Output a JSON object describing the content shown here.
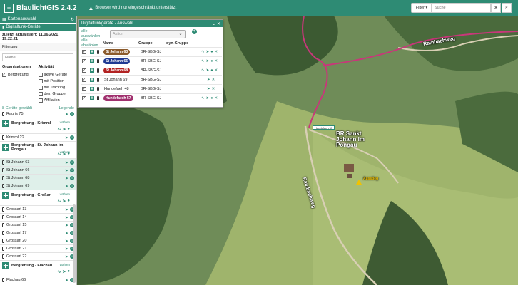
{
  "app": {
    "title": "BlaulichtGIS 2.4.2",
    "logo_icon": "cross-icon"
  },
  "warning": {
    "text": "Browser wird nur eingeschränkt unterstützt",
    "icon": "warning-icon"
  },
  "toolbar": {
    "filter_label": "Filter ▾",
    "search_placeholder": "Suche",
    "clear_icon": "close-icon",
    "search_icon": "search-icon"
  },
  "sidebar": {
    "map_select_label": "Kartenauswahl",
    "panel_title": "Digitalfunk-Geräte",
    "updated": "zuletzt aktualisiert: 11.06.2021 19:22:21",
    "filter_label": "Filterung",
    "name_placeholder": "Name",
    "org_header": "Organisationen",
    "org_items": [
      {
        "label": "Bergrettung",
        "checked": true
      }
    ],
    "act_header": "Aktivität",
    "act_items": [
      {
        "label": "aktive Geräte",
        "checked": false
      },
      {
        "label": "mit Position",
        "checked": false
      },
      {
        "label": "mit Tracking",
        "checked": false
      },
      {
        "label": "dyn. Gruppe",
        "checked": false
      },
      {
        "label": "Affiliation",
        "checked": false
      }
    ],
    "count_label": "8 Geräte gewählt",
    "legend_label": "Legende",
    "top_device": "Rauris 75",
    "add_label": "wählen",
    "groups": [
      {
        "name": "Bergrettung - Krimml",
        "devices": [
          {
            "name": "Krimml 22",
            "selected": false
          }
        ]
      },
      {
        "name": "Bergrettung - St. Johann im Pongau",
        "devices": [
          {
            "name": "St Johann 63",
            "selected": true
          },
          {
            "name": "St Johann 66",
            "selected": true
          },
          {
            "name": "St Johann 68",
            "selected": true
          },
          {
            "name": "St Johann 69",
            "selected": true
          }
        ]
      },
      {
        "name": "Bergrettung - Großarl",
        "devices": [
          {
            "name": "Grossarl 13",
            "selected": false
          },
          {
            "name": "Grossarl 14",
            "selected": false
          },
          {
            "name": "Grossarl 15",
            "selected": false
          },
          {
            "name": "Grossarl 17",
            "selected": false
          },
          {
            "name": "Grossarl 20",
            "selected": false
          },
          {
            "name": "Grossarl 21",
            "selected": false
          },
          {
            "name": "Grossarl 22",
            "selected": false
          }
        ]
      },
      {
        "name": "Bergrettung - Flachau",
        "devices": [
          {
            "name": "Flachau 66",
            "selected": false
          }
        ]
      }
    ]
  },
  "dialog": {
    "title": "Digitalfunkgeräte - Auswahl",
    "select_all": "alle auswählen",
    "deselect_all": "alle abwählen",
    "action_placeholder": "Aktion",
    "columns": {
      "name": "Name",
      "group": "Gruppe",
      "dyn": "dyn-Gruppe"
    },
    "rows": [
      {
        "name": "St Johann 63",
        "group": "BR-SBG-SJ",
        "badge": "#8b5a2b"
      },
      {
        "name": "St Johann 66",
        "group": "BR-SBG-SJ",
        "badge": "#1f3a93"
      },
      {
        "name": "St Johann 68",
        "group": "BR-SBG-SJ",
        "badge": "#b22222"
      },
      {
        "name": "St Johann 69",
        "group": "BR-SBG-SJ",
        "badge": ""
      },
      {
        "name": "Hundefaeh 48",
        "group": "BR-SBG-SJ",
        "badge": ""
      },
      {
        "name": "Hundefaech 57",
        "group": "BR-SBG-SJ",
        "badge": "#a0306e"
      }
    ]
  },
  "map": {
    "labels": {
      "road_top": "Rainbachweg",
      "road_mid": "Rainbachweg",
      "station": "BR Sankt Johann im Pongau",
      "marker": "Hundefaeh 57",
      "poi": "Ausstieg"
    },
    "track_color": "#c8377a",
    "accent": "#2e8b74"
  }
}
